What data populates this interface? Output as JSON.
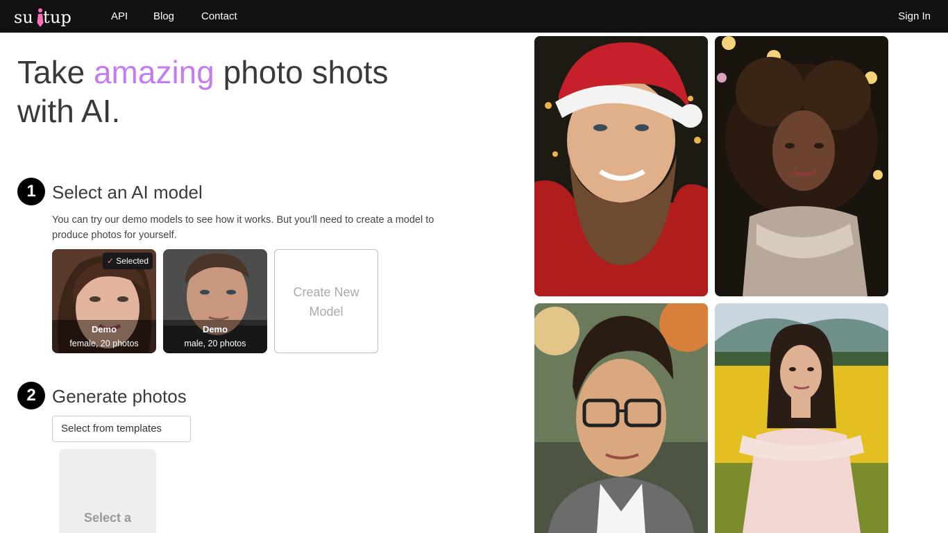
{
  "nav": {
    "logo_text": "suitup",
    "links": [
      "API",
      "Blog",
      "Contact"
    ],
    "sign_in": "Sign In"
  },
  "hero": {
    "word1": "Take",
    "accent_word": "amazing",
    "rest_line1": "photo shots",
    "line2": "with AI.",
    "accent_color": "#c57cf0"
  },
  "step1": {
    "number": "1",
    "title": "Select an AI model",
    "description": "You can try our demo models to see how it works. But you'll need to create a model to produce photos for yourself.",
    "models": [
      {
        "name": "Demo",
        "meta": "female, 20 photos",
        "selected": true
      },
      {
        "name": "Demo",
        "meta": "male, 20 photos",
        "selected": false
      }
    ],
    "selected_label": "Selected",
    "selected_check": "✓",
    "create_label": "Create New Model"
  },
  "step2": {
    "number": "2",
    "title": "Generate photos",
    "template_select": "Select from templates",
    "template_card_label": "Select a"
  },
  "gallery": {
    "icons": [
      "photo-santa-man",
      "photo-curly-woman-sequin-dress",
      "photo-man-glasses",
      "photo-woman-flower-field"
    ]
  }
}
